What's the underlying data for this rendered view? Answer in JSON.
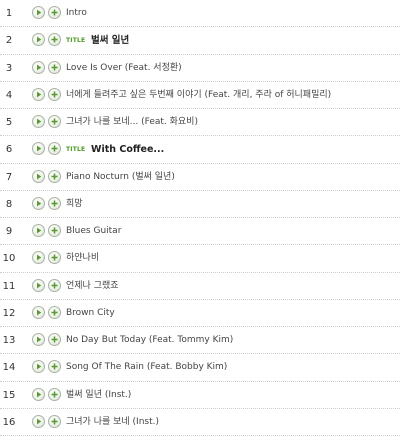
{
  "tracks": [
    {
      "num": "1",
      "title": "Intro",
      "title_track": false
    },
    {
      "num": "2",
      "title": "벌써 일년",
      "title_track": true
    },
    {
      "num": "3",
      "title": "Love Is Over (Feat. 서정환)",
      "title_track": false
    },
    {
      "num": "4",
      "title": "너에게 들려주고 싶은 두번째 이야기 (Feat. 개리, 주라 of 허니패밀리)",
      "title_track": false
    },
    {
      "num": "5",
      "title": "그녀가 나를 보네... (Feat. 화요비)",
      "title_track": false
    },
    {
      "num": "6",
      "title": "With Coffee...",
      "title_track": true
    },
    {
      "num": "7",
      "title": "Piano Nocturn (벌써 일년)",
      "title_track": false
    },
    {
      "num": "8",
      "title": "희망",
      "title_track": false
    },
    {
      "num": "9",
      "title": "Blues Guitar",
      "title_track": false
    },
    {
      "num": "10",
      "title": "하얀나비",
      "title_track": false
    },
    {
      "num": "11",
      "title": "언제나 그랬죠",
      "title_track": false
    },
    {
      "num": "12",
      "title": "Brown City",
      "title_track": false
    },
    {
      "num": "13",
      "title": "No Day But Today (Feat. Tommy Kim)",
      "title_track": false
    },
    {
      "num": "14",
      "title": "Song Of The Rain (Feat. Bobby Kim)",
      "title_track": false
    },
    {
      "num": "15",
      "title": "벌써 일년 (Inst.)",
      "title_track": false
    },
    {
      "num": "16",
      "title": "그녀가 나를 보네 (Inst.)",
      "title_track": false
    }
  ],
  "title_badge_text": "TITLE",
  "icons": {
    "play": "play-icon",
    "add": "add-icon"
  },
  "colors": {
    "icon_green": "#5a9a34",
    "badge_green": "#4a9a1c"
  }
}
